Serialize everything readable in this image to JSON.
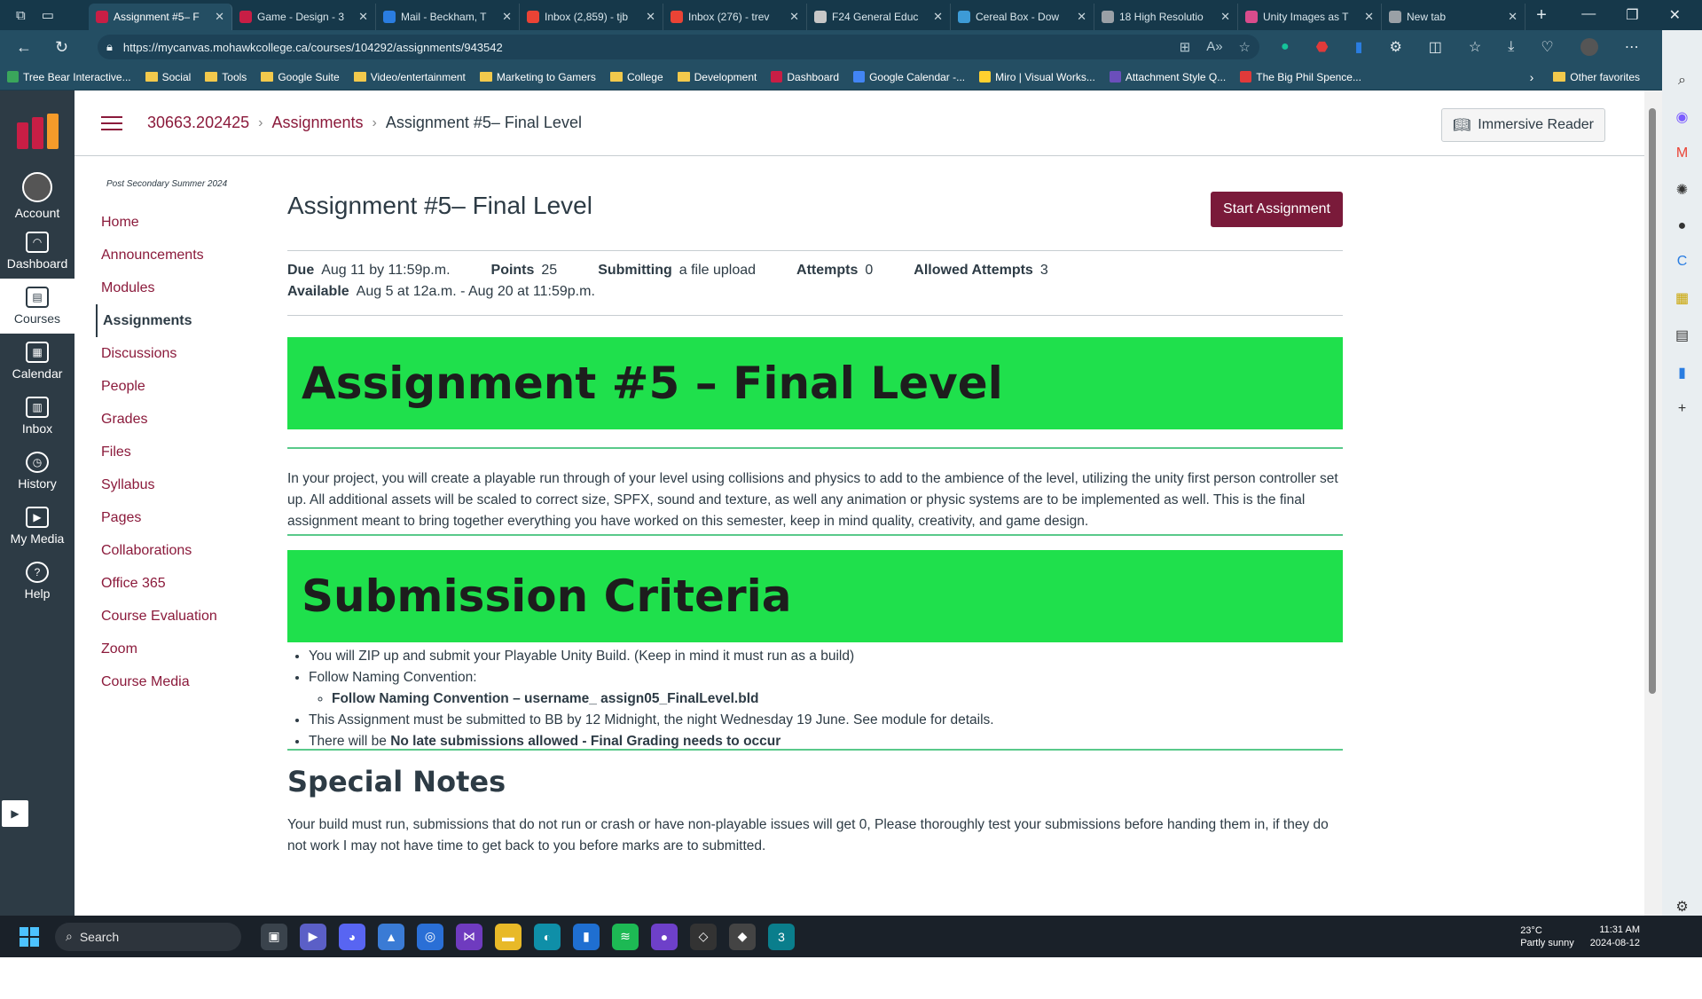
{
  "browser": {
    "tabs": [
      {
        "title": "Assignment #5– F",
        "active": true,
        "color": "#c81e45"
      },
      {
        "title": "Game - Design - 3",
        "active": false,
        "color": "#c81e45"
      },
      {
        "title": "Mail - Beckham, T",
        "active": false,
        "color": "#2a7de1"
      },
      {
        "title": "Inbox (2,859) - tjb",
        "active": false,
        "color": "#ea4335"
      },
      {
        "title": "Inbox (276) - trev",
        "active": false,
        "color": "#ea4335"
      },
      {
        "title": "F24 General Educ",
        "active": false,
        "color": "#c7c7c7"
      },
      {
        "title": "Cereal Box - Dow",
        "active": false,
        "color": "#3d9bd6"
      },
      {
        "title": "18 High Resolutio",
        "active": false,
        "color": "#9aa0a6"
      },
      {
        "title": "Unity Images as T",
        "active": false,
        "color": "#d94c8c"
      },
      {
        "title": "New tab",
        "active": false,
        "color": "#9aa0a6"
      }
    ],
    "url": "https://mycanvas.mohawkcollege.ca/courses/104292/assignments/943542",
    "bookmarks": [
      {
        "label": "Tree Bear Interactive...",
        "type": "icon",
        "color": "#3aa65b"
      },
      {
        "label": "Social",
        "type": "folder"
      },
      {
        "label": "Tools",
        "type": "folder"
      },
      {
        "label": "Google Suite",
        "type": "folder"
      },
      {
        "label": "Video/entertainment",
        "type": "folder"
      },
      {
        "label": "Marketing to Gamers",
        "type": "folder"
      },
      {
        "label": "College",
        "type": "folder"
      },
      {
        "label": "Development",
        "type": "folder"
      },
      {
        "label": "Dashboard",
        "type": "icon",
        "color": "#c81e45"
      },
      {
        "label": "Google Calendar -...",
        "type": "icon",
        "color": "#4285f4"
      },
      {
        "label": "Miro | Visual Works...",
        "type": "icon",
        "color": "#ffd02f"
      },
      {
        "label": "Attachment Style Q...",
        "type": "icon",
        "color": "#6b4fbb"
      },
      {
        "label": "The Big Phil Spence...",
        "type": "icon",
        "color": "#e03a3a"
      }
    ],
    "other_favorites": "Other favorites"
  },
  "global_nav": {
    "items": [
      {
        "label": "Account",
        "icon": "account-avatar"
      },
      {
        "label": "Dashboard",
        "icon": "dashboard-icon"
      },
      {
        "label": "Courses",
        "icon": "courses-icon",
        "active": true
      },
      {
        "label": "Calendar",
        "icon": "calendar-icon"
      },
      {
        "label": "Inbox",
        "icon": "inbox-icon"
      },
      {
        "label": "History",
        "icon": "history-icon"
      },
      {
        "label": "My Media",
        "icon": "media-icon"
      },
      {
        "label": "Help",
        "icon": "help-icon"
      }
    ]
  },
  "header": {
    "course_code": "30663.202425",
    "crumb_assignments": "Assignments",
    "crumb_current": "Assignment #5– Final Level",
    "immersive_reader": "Immersive Reader"
  },
  "course_nav": {
    "term": "Post Secondary Summer 2024",
    "items": [
      "Home",
      "Announcements",
      "Modules",
      "Assignments",
      "Discussions",
      "People",
      "Grades",
      "Files",
      "Syllabus",
      "Pages",
      "Collaborations",
      "Office 365",
      "Course Evaluation",
      "Zoom",
      "Course Media"
    ],
    "active_index": 3
  },
  "assignment": {
    "title": "Assignment #5– Final Level",
    "start_button": "Start Assignment",
    "due_label": "Due",
    "due_value": "Aug 11 by 11:59p.m.",
    "points_label": "Points",
    "points_value": "25",
    "submitting_label": "Submitting",
    "submitting_value": "a file upload",
    "attempts_label": "Attempts",
    "attempts_value": "0",
    "allowed_label": "Allowed Attempts",
    "allowed_value": "3",
    "available_label": "Available",
    "available_value": "Aug 5 at 12a.m. - Aug 20 at 11:59p.m.",
    "banner1": "Assignment #5 – Final Level",
    "intro": "In your project, you will create a playable run through of your level using collisions and physics to add to the ambience of the level, utilizing the unity first person controller set up. All additional assets will be scaled to correct size, SPFX, sound and texture, as well any animation or physic systems are to be implemented as well. This is the final assignment meant to bring together everything you have worked on this semester, keep in mind quality, creativity, and game design.",
    "banner2": "Submission Criteria",
    "criteria_1": "You will ZIP up and submit your Playable Unity Build. (Keep in mind it must run as a build)",
    "criteria_2": "Follow Naming Convention:",
    "criteria_2a": "Follow Naming Convention – username_ assign05_FinalLevel.bld",
    "criteria_3": "This Assignment must be submitted to BB by 12 Midnight, the night Wednesday 19 June. See module for details.",
    "criteria_4_pre": "There will be ",
    "criteria_4_bold": "No late submissions allowed - Final Grading needs to occur",
    "notes_heading": "Special Notes",
    "notes_text": "Your build must run, submissions that do not run or crash or have non-playable issues will get 0, Please thoroughly test your submissions before handing them in, if they do not work I may not have time to get back to you before marks are to submitted."
  },
  "taskbar": {
    "search": "Search",
    "weather_temp": "23°C",
    "weather_desc": "Partly sunny",
    "time": "11:31 AM",
    "date": "2024-08-12"
  }
}
